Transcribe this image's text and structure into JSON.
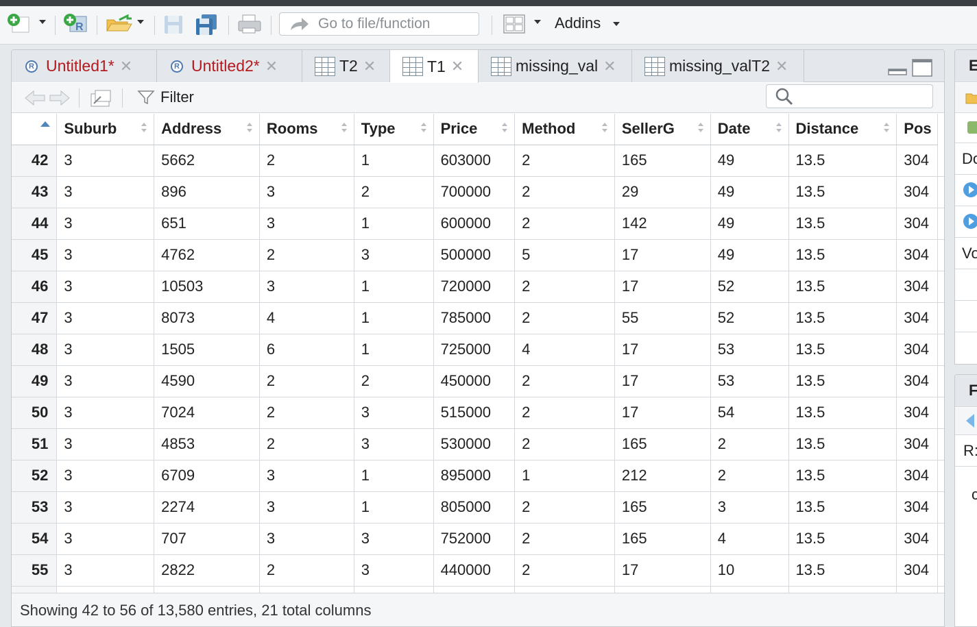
{
  "toolbar": {
    "goto_placeholder": "Go to file/function",
    "addins_label": "Addins"
  },
  "tabs": [
    {
      "label": "Untitled1*",
      "kind": "r-script",
      "modified": true
    },
    {
      "label": "Untitled2*",
      "kind": "r-script",
      "modified": true
    },
    {
      "label": "T2",
      "kind": "data"
    },
    {
      "label": "T1",
      "kind": "data",
      "active": true
    },
    {
      "label": "missing_val",
      "kind": "data"
    },
    {
      "label": "missing_valT2",
      "kind": "data"
    }
  ],
  "viewer": {
    "filter_label": "Filter",
    "columns": [
      "Suburb",
      "Address",
      "Rooms",
      "Type",
      "Price",
      "Method",
      "SellerG",
      "Date",
      "Distance",
      "Pos"
    ],
    "rows": [
      {
        "n": "42",
        "cells": [
          "3",
          "5662",
          "2",
          "1",
          "603000",
          "2",
          "165",
          "49",
          "13.5",
          "304"
        ]
      },
      {
        "n": "43",
        "cells": [
          "3",
          "896",
          "3",
          "2",
          "700000",
          "2",
          "29",
          "49",
          "13.5",
          "304"
        ]
      },
      {
        "n": "44",
        "cells": [
          "3",
          "651",
          "3",
          "1",
          "600000",
          "2",
          "142",
          "49",
          "13.5",
          "304"
        ]
      },
      {
        "n": "45",
        "cells": [
          "3",
          "4762",
          "2",
          "3",
          "500000",
          "5",
          "17",
          "49",
          "13.5",
          "304"
        ]
      },
      {
        "n": "46",
        "cells": [
          "3",
          "10503",
          "3",
          "1",
          "720000",
          "2",
          "17",
          "52",
          "13.5",
          "304"
        ]
      },
      {
        "n": "47",
        "cells": [
          "3",
          "8073",
          "4",
          "1",
          "785000",
          "2",
          "55",
          "52",
          "13.5",
          "304"
        ]
      },
      {
        "n": "48",
        "cells": [
          "3",
          "1505",
          "6",
          "1",
          "725000",
          "4",
          "17",
          "53",
          "13.5",
          "304"
        ]
      },
      {
        "n": "49",
        "cells": [
          "3",
          "4590",
          "2",
          "2",
          "450000",
          "2",
          "17",
          "53",
          "13.5",
          "304"
        ]
      },
      {
        "n": "50",
        "cells": [
          "3",
          "7024",
          "2",
          "3",
          "515000",
          "2",
          "17",
          "54",
          "13.5",
          "304"
        ]
      },
      {
        "n": "51",
        "cells": [
          "3",
          "4853",
          "2",
          "3",
          "530000",
          "2",
          "165",
          "2",
          "13.5",
          "304"
        ]
      },
      {
        "n": "52",
        "cells": [
          "3",
          "6709",
          "3",
          "1",
          "895000",
          "1",
          "212",
          "2",
          "13.5",
          "304"
        ]
      },
      {
        "n": "53",
        "cells": [
          "3",
          "2274",
          "3",
          "1",
          "805000",
          "2",
          "165",
          "3",
          "13.5",
          "304"
        ]
      },
      {
        "n": "54",
        "cells": [
          "3",
          "707",
          "3",
          "3",
          "752000",
          "2",
          "165",
          "4",
          "13.5",
          "304"
        ]
      },
      {
        "n": "55",
        "cells": [
          "3",
          "2822",
          "2",
          "3",
          "440000",
          "2",
          "17",
          "10",
          "13.5",
          "304"
        ]
      },
      {
        "n": "",
        "cells": [
          "",
          "",
          "",
          "",
          "",
          "",
          "",
          "",
          "",
          ""
        ]
      }
    ],
    "status": "Showing 42 to 56 of 13,580 entries, 21 total columns"
  },
  "right_panel": {
    "top_header": "E",
    "items": [
      "Do",
      "Vo"
    ],
    "bottom_header": "F",
    "bottom_label": "R:",
    "bottom_text": "c"
  },
  "colors": {
    "modified_tab_text": "#b4191d",
    "sort_arrow": "#4f86bb",
    "r_icon": "#4f79b1"
  }
}
